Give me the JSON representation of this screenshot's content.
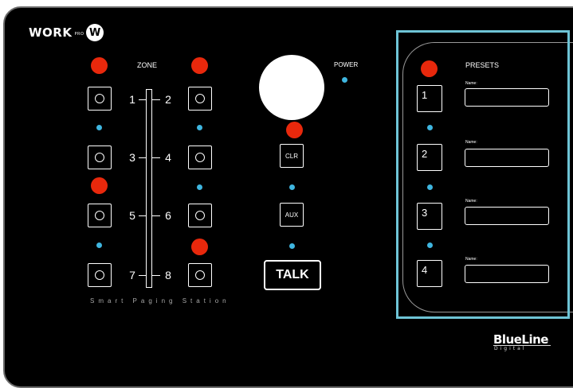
{
  "brand": {
    "logo_text": "WORK",
    "logo_pro": "PRO",
    "logo_mark": "W",
    "product_brand": "BlueLine",
    "product_sub": "Digital"
  },
  "zone": {
    "title": "ZONE",
    "subtitle": "Smart Paging Station",
    "numbers": [
      "1",
      "2",
      "3",
      "4",
      "5",
      "6",
      "7",
      "8"
    ]
  },
  "center": {
    "power_label": "POWER",
    "clr_label": "CLR",
    "aux_label": "AUX",
    "talk_label": "TALK"
  },
  "presets": {
    "title": "PRESETS",
    "name_label": "Name:",
    "items": [
      {
        "number": "1",
        "name": ""
      },
      {
        "number": "2",
        "name": ""
      },
      {
        "number": "3",
        "name": ""
      },
      {
        "number": "4",
        "name": ""
      }
    ]
  },
  "colors": {
    "panel": "#000000",
    "led_red": "#e8280c",
    "led_blue": "#3fb6e0",
    "frame": "#6ec4d6"
  }
}
